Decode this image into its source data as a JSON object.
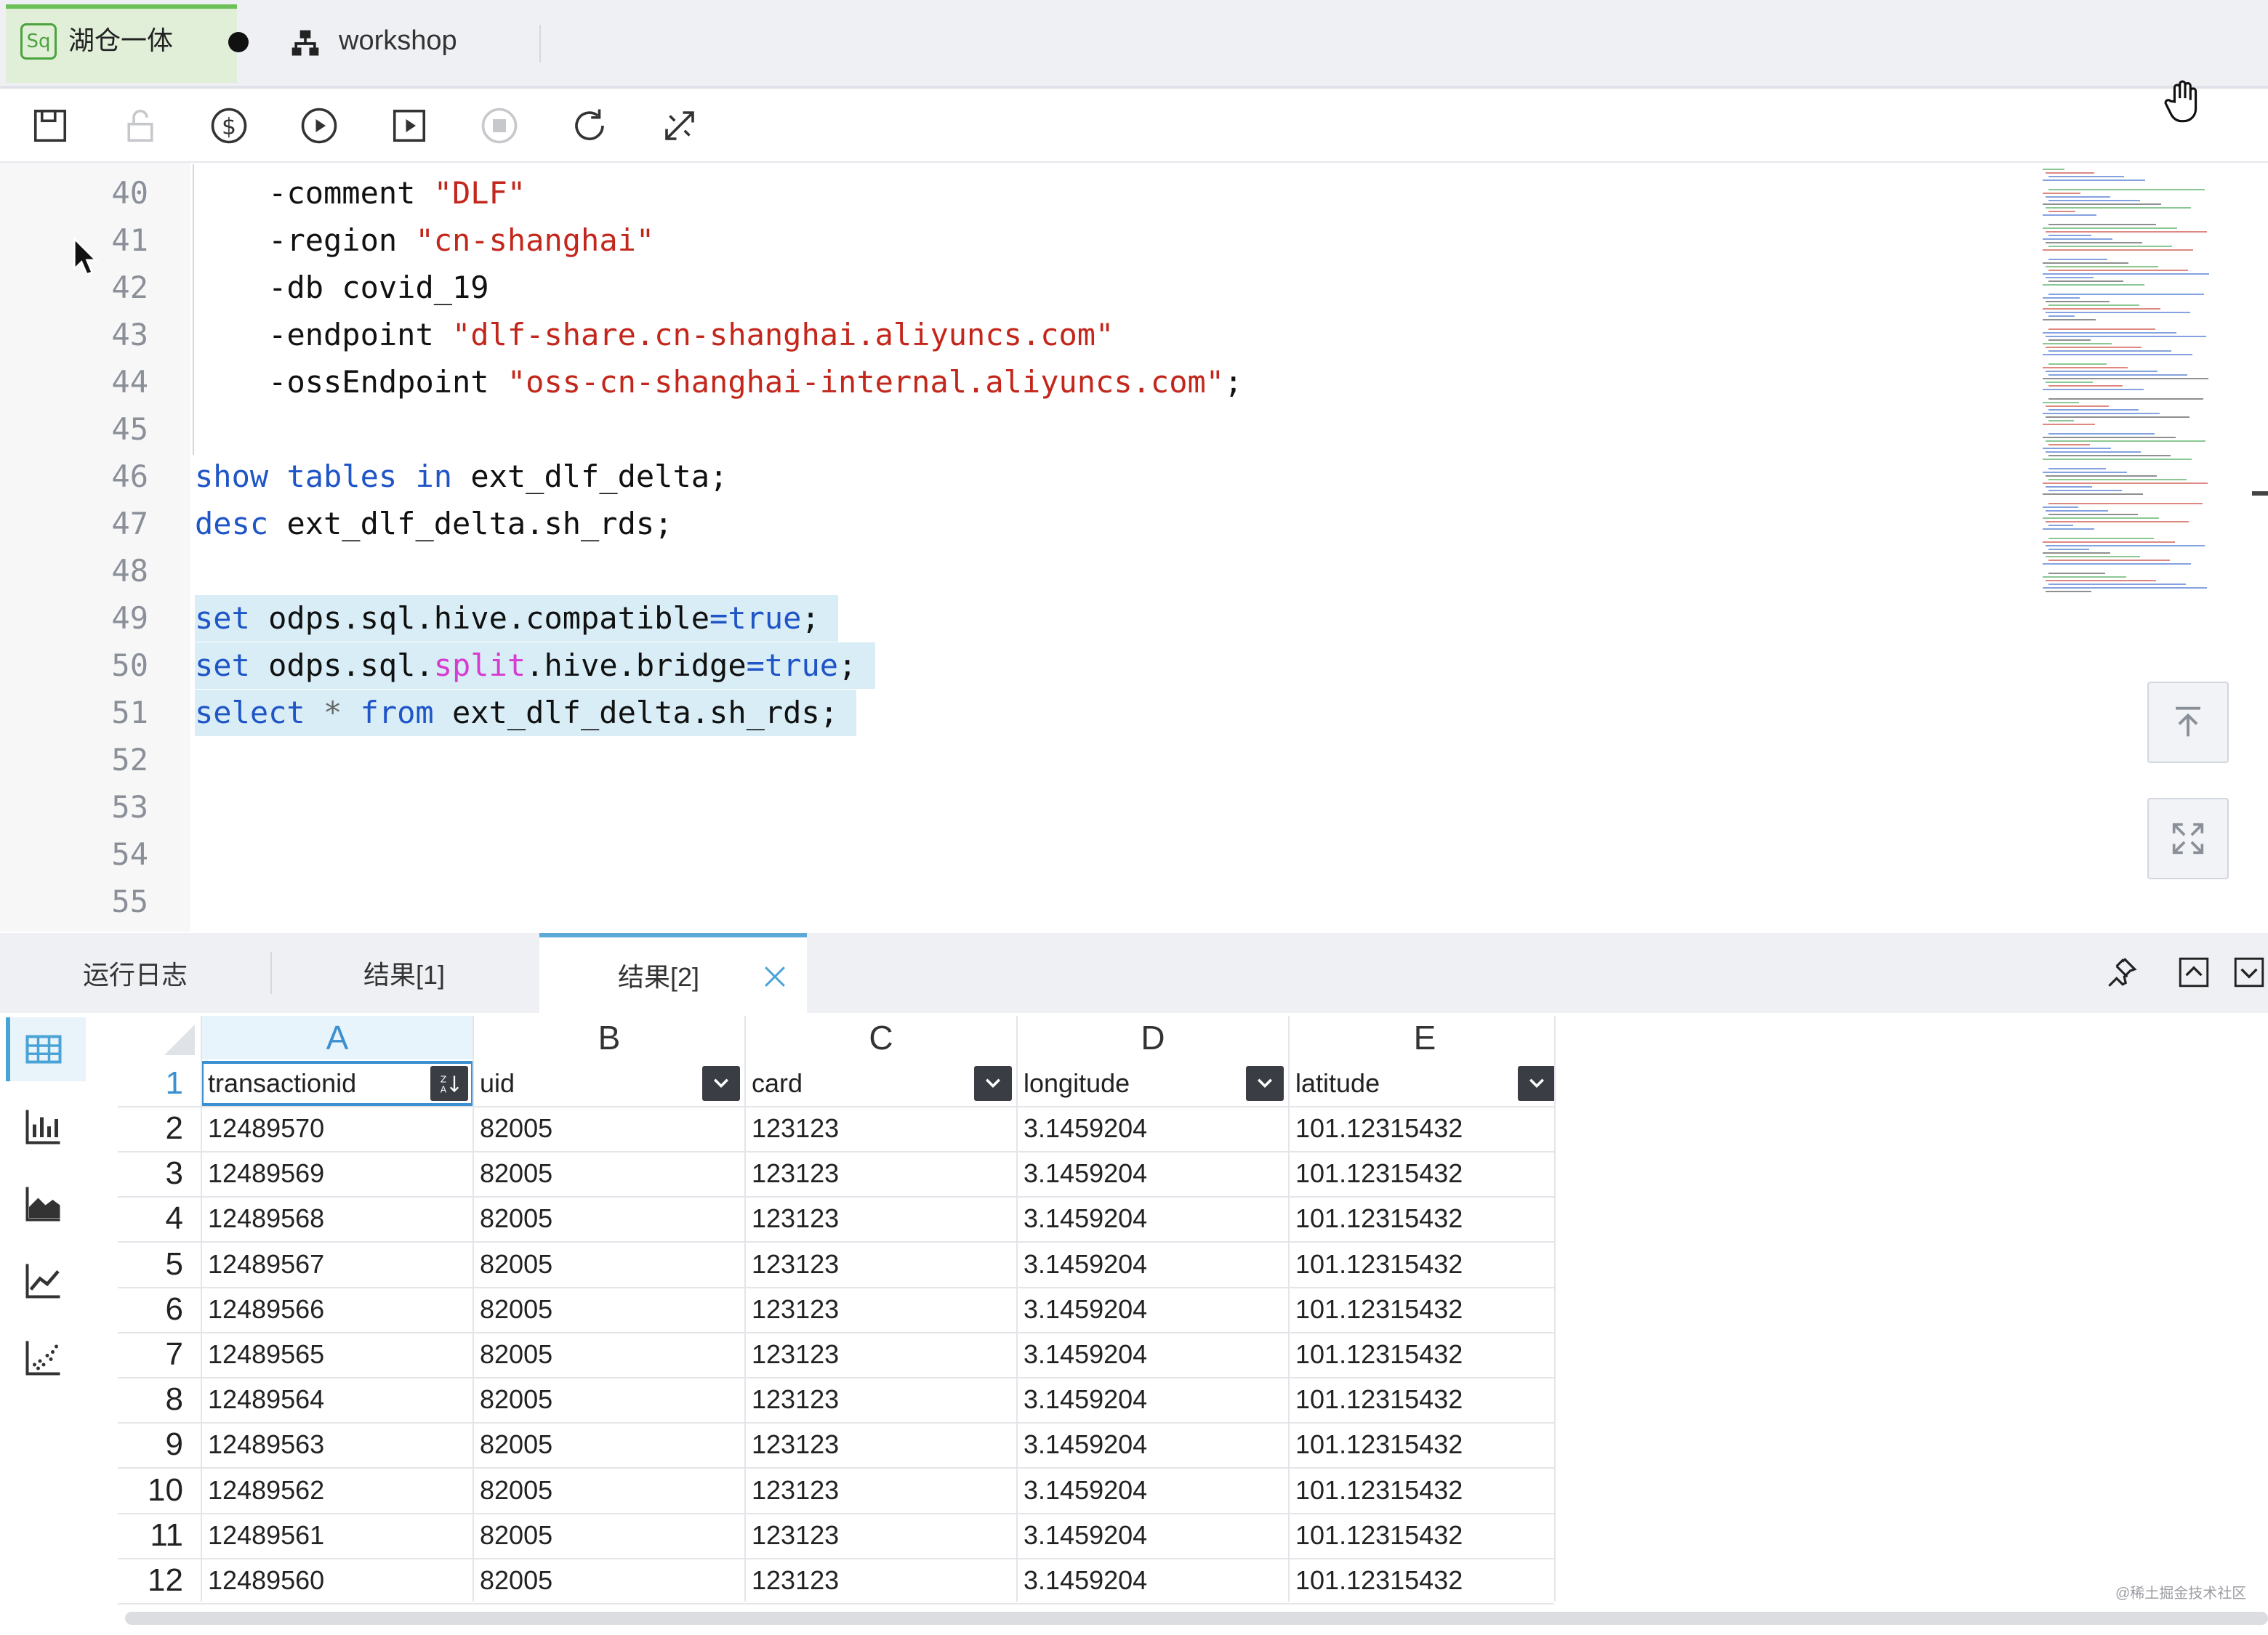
{
  "tabs": [
    {
      "label": "湖仓一体",
      "icon": "sql-file-icon",
      "modified": true
    },
    {
      "label": "workshop",
      "icon": "workflow-icon"
    }
  ],
  "toolbar": {
    "icons": [
      "save-icon",
      "lock-icon",
      "cost-estimate-icon",
      "run-icon",
      "run-selected-icon",
      "stop-icon",
      "refresh-icon",
      "format-icon"
    ]
  },
  "editor": {
    "lines": [
      {
        "n": "40"
      },
      {
        "n": "41"
      },
      {
        "n": "42"
      },
      {
        "n": "43"
      },
      {
        "n": "44"
      },
      {
        "n": "45"
      },
      {
        "n": "46"
      },
      {
        "n": "47"
      },
      {
        "n": "48"
      },
      {
        "n": "49"
      },
      {
        "n": "50"
      },
      {
        "n": "51"
      },
      {
        "n": "52"
      },
      {
        "n": "53"
      },
      {
        "n": "54"
      },
      {
        "n": "55"
      }
    ],
    "code": {
      "l40_a": "-comment ",
      "l40_b": "\"DLF\"",
      "l41_a": "-region ",
      "l41_b": "\"cn-shanghai\"",
      "l42": "-db covid_19",
      "l43_a": "-endpoint ",
      "l43_b": "\"dlf-share.cn-shanghai.aliyuncs.com\"",
      "l44_a": "-ossEndpoint ",
      "l44_b": "\"oss-cn-shanghai-internal.aliyuncs.com\"",
      "l44_c": ";",
      "l46_kw1": "show",
      "l46_kw2": " tables",
      "l46_kw3": " in",
      "l46_rest": " ext_dlf_delta;",
      "l47_kw": "desc",
      "l47_rest": " ext_dlf_delta.sh_rds;",
      "l49_kw": "set",
      "l49_mid": " odps.sql.hive.compatible",
      "l49_eq": "=",
      "l49_val": "true",
      "l49_end": ";",
      "l50_kw": "set",
      "l50_mid1": " odps.sql.",
      "l50_fn": "split",
      "l50_mid2": ".hive.bridge",
      "l50_eq": "=",
      "l50_val": "true",
      "l50_end": ";",
      "l51_kw1": "select",
      "l51_star": " * ",
      "l51_kw2": "from",
      "l51_rest": " ext_dlf_delta.sh_rds;"
    }
  },
  "results": {
    "tabs": [
      {
        "label": "运行日志"
      },
      {
        "label": "结果[1]"
      },
      {
        "label": "结果[2]",
        "active": true
      }
    ],
    "columns": [
      "A",
      "B",
      "C",
      "D",
      "E"
    ],
    "header_row": {
      "num": "1",
      "fields": [
        "transactionid",
        "uid",
        "card",
        "longitude",
        "latitude"
      ]
    },
    "rows": [
      {
        "num": "2",
        "cells": [
          "12489570",
          "82005",
          "123123",
          "3.1459204",
          "101.12315432"
        ]
      },
      {
        "num": "3",
        "cells": [
          "12489569",
          "82005",
          "123123",
          "3.1459204",
          "101.12315432"
        ]
      },
      {
        "num": "4",
        "cells": [
          "12489568",
          "82005",
          "123123",
          "3.1459204",
          "101.12315432"
        ]
      },
      {
        "num": "5",
        "cells": [
          "12489567",
          "82005",
          "123123",
          "3.1459204",
          "101.12315432"
        ]
      },
      {
        "num": "6",
        "cells": [
          "12489566",
          "82005",
          "123123",
          "3.1459204",
          "101.12315432"
        ]
      },
      {
        "num": "7",
        "cells": [
          "12489565",
          "82005",
          "123123",
          "3.1459204",
          "101.12315432"
        ]
      },
      {
        "num": "8",
        "cells": [
          "12489564",
          "82005",
          "123123",
          "3.1459204",
          "101.12315432"
        ]
      },
      {
        "num": "9",
        "cells": [
          "12489563",
          "82005",
          "123123",
          "3.1459204",
          "101.12315432"
        ]
      },
      {
        "num": "10",
        "cells": [
          "12489562",
          "82005",
          "123123",
          "3.1459204",
          "101.12315432"
        ]
      },
      {
        "num": "11",
        "cells": [
          "12489561",
          "82005",
          "123123",
          "3.1459204",
          "101.12315432"
        ]
      },
      {
        "num": "12",
        "cells": [
          "12489560",
          "82005",
          "123123",
          "3.1459204",
          "101.12315432"
        ]
      }
    ],
    "view_modes": [
      "table-view-icon",
      "bar-chart-icon",
      "area-chart-icon",
      "line-chart-icon",
      "scatter-chart-icon"
    ]
  },
  "watermark": "@稀土掘金技术社区",
  "colors": {
    "keyword": "#1f55c7",
    "string": "#c3271c",
    "function": "#d63bd2",
    "selection": "#d8edf6",
    "accent": "#4aa3d6",
    "tab_active": "#6dc159"
  }
}
